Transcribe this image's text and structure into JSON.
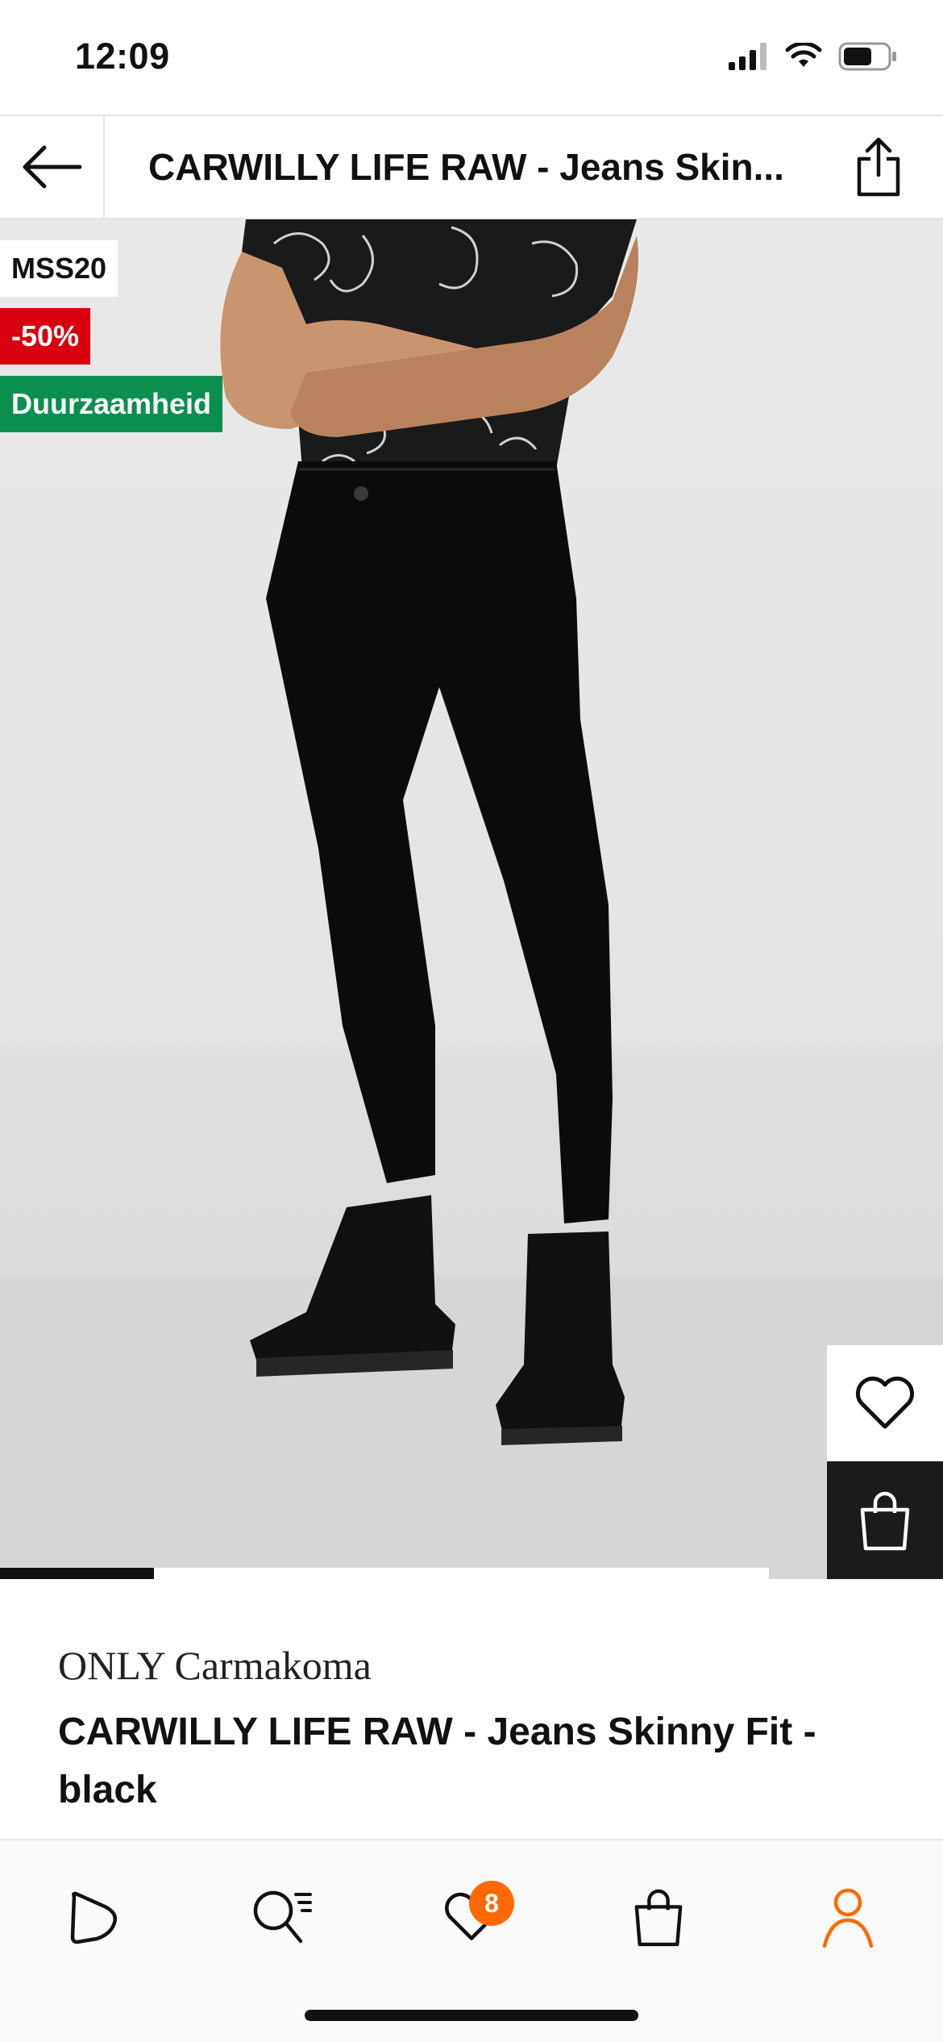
{
  "status_bar": {
    "time": "12:09"
  },
  "header": {
    "title": "CARWILLY LIFE RAW - Jeans Skin...",
    "back_icon": "arrow-left-icon",
    "share_icon": "share-icon"
  },
  "badges": {
    "code": "MSS20",
    "discount": "-50%",
    "sustainability": "Duurzaamheid"
  },
  "gallery": {
    "progress": 0.2,
    "current_index": 1,
    "total_images": 5
  },
  "product": {
    "brand": "ONLY Carmakoma",
    "name": "CARWILLY LIFE RAW - Jeans Skinny Fit - black"
  },
  "tab_bar": {
    "items": [
      {
        "icon": "home-play-icon"
      },
      {
        "icon": "search-icon"
      },
      {
        "icon": "heart-icon",
        "badge": "8"
      },
      {
        "icon": "bag-icon"
      },
      {
        "icon": "profile-icon",
        "active": true
      }
    ]
  },
  "colors": {
    "accent": "#ff6900",
    "discount": "#d8000f",
    "sustainability": "#0a8f4f"
  }
}
